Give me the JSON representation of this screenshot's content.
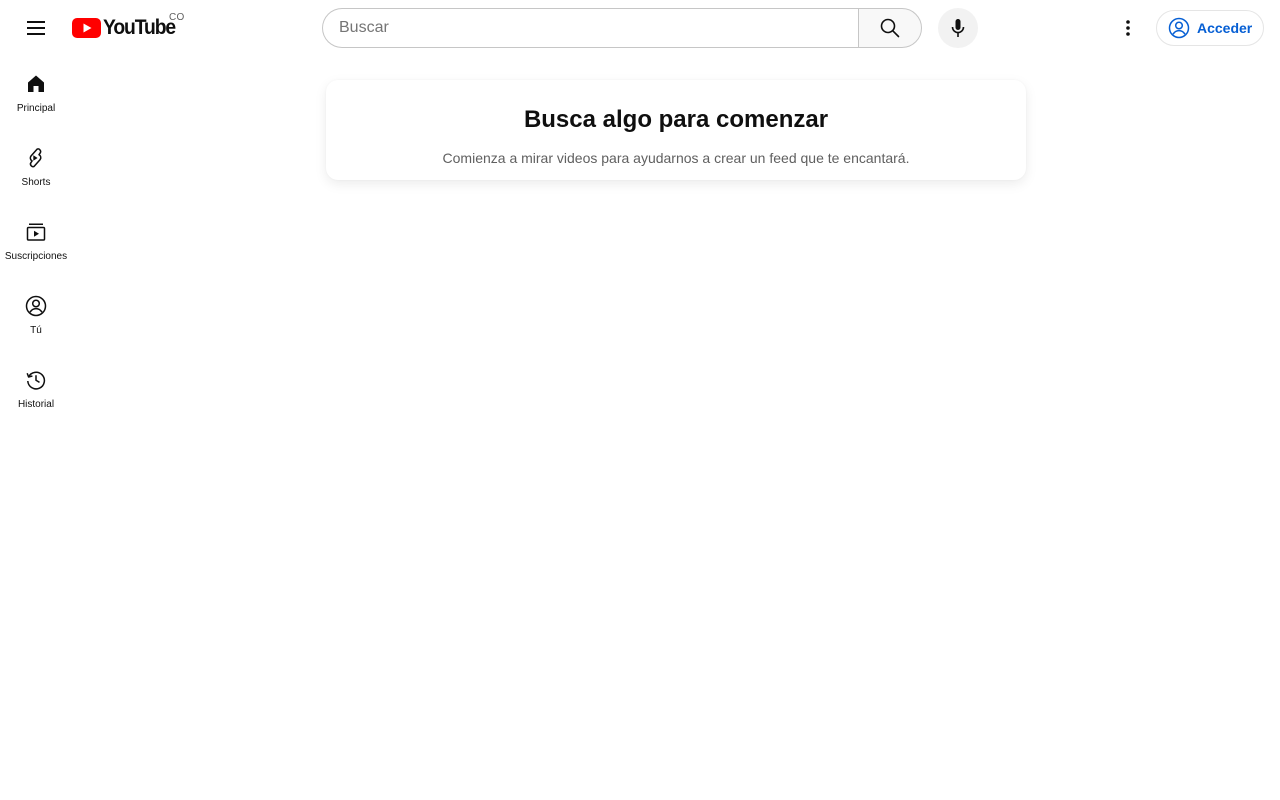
{
  "header": {
    "menu_icon": "hamburger-menu-icon",
    "logo_text": "YouTube",
    "country_code": "CO",
    "search_placeholder": "Buscar",
    "search_value": "",
    "search_icon": "magnifier-icon",
    "mic_icon": "microphone-icon",
    "more_icon": "vertical-dots-icon",
    "signin_label": "Acceder",
    "signin_icon": "account-circle-icon",
    "brand_red": "#ff0000",
    "link_blue": "#065fd4"
  },
  "sidebar": {
    "items": [
      {
        "label": "Principal",
        "icon": "home-icon"
      },
      {
        "label": "Shorts",
        "icon": "shorts-icon"
      },
      {
        "label": "Suscripciones",
        "icon": "subscriptions-icon"
      },
      {
        "label": "Tú",
        "icon": "user-circle-icon"
      },
      {
        "label": "Historial",
        "icon": "history-icon"
      }
    ]
  },
  "main": {
    "prompt_title": "Busca algo para comenzar",
    "prompt_subtitle": "Comienza a mirar videos para ayudarnos a crear un feed que te encantará."
  }
}
